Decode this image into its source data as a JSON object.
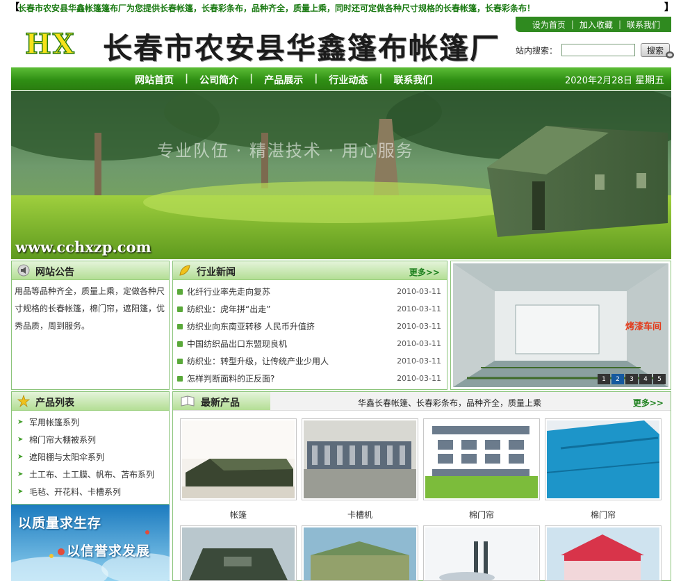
{
  "topbar": {
    "bracket_left": "【",
    "bracket_right": "】",
    "marquee": "长春市农安县华鑫帐篷篷布厂为您提供长春帐篷，长春彩条布，品种齐全，质量上乘，同时还可定做各种尺寸规格的长春帐篷，长春彩条布！"
  },
  "header": {
    "logo_hx": "HX",
    "company_name": "长春市农安县华鑫篷布帐篷厂",
    "top_links": [
      "设为首页",
      "加入收藏",
      "联系我们"
    ],
    "search_label": "站内搜索：",
    "search_value": "",
    "search_button": "搜索"
  },
  "nav": {
    "items": [
      "网站首页",
      "公司简介",
      "产品展示",
      "行业动态",
      "联系我们"
    ],
    "separator": "|",
    "date": "2020年2月28日",
    "weekday": "星期五"
  },
  "banner": {
    "slogan": "专业队伍 · 精湛技术 · 用心服务",
    "url": "www.cchxzp.com"
  },
  "notice": {
    "title": "网站公告",
    "text": "用品等品种齐全，质量上乘，定做各种尺寸规格的长春帐篷，棉门帘，遮阳篷，优秀品质，周到服务。"
  },
  "news": {
    "title": "行业新闻",
    "more": "更多>>",
    "items": [
      {
        "title": "化纤行业率先走向复苏",
        "date": "2010-03-11"
      },
      {
        "title": "纺织业：虎年拼“出走”",
        "date": "2010-03-11"
      },
      {
        "title": "纺织业向东南亚转移 人民币升值挤",
        "date": "2010-03-11"
      },
      {
        "title": "中国纺织品出口东盟现良机",
        "date": "2010-03-11"
      },
      {
        "title": "纺织业：转型升级，让传统产业少用人",
        "date": "2010-03-11"
      },
      {
        "title": "怎样判断面料的正反面?",
        "date": "2010-03-11"
      }
    ]
  },
  "showcase": {
    "label": "烤漆车间",
    "pages": [
      "1",
      "2",
      "3",
      "4",
      "5"
    ],
    "active_page": 2
  },
  "products": {
    "title": "产品列表",
    "items": [
      "军用帐篷系列",
      "棉门帘大棚被系列",
      "遮阳棚与太阳伞系列",
      "土工布、土工膜、帆布、苫布系列",
      "毛毡、开花料、卡槽系列"
    ]
  },
  "ad": {
    "line1": "以质量求生存",
    "line2": "以信誉求发展"
  },
  "latest": {
    "title": "最新产品",
    "tagline": "华鑫长春帐篷、长春彩条布，品种齐全，质量上乘",
    "more": "更多>>",
    "row1": [
      "帐篷",
      "卡槽机",
      "棉门帘",
      "棉门帘"
    ]
  },
  "colors": {
    "brand_green": "#2f8f14",
    "accent_red": "#e43a1a",
    "marquee_green": "#1a7a12"
  }
}
